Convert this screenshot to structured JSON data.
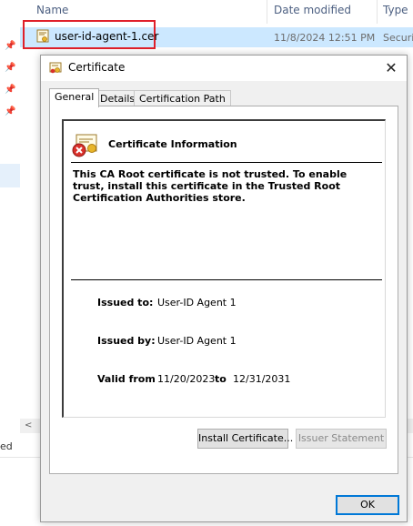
{
  "explorer": {
    "columns": {
      "name": "Name",
      "date_modified": "Date modified",
      "type": "Type"
    },
    "selected_file": {
      "name": "user-id-agent-1.cer",
      "date": "11/8/2024 12:51 PM",
      "type": "Securi"
    },
    "scroll_left_arrow": "<",
    "status_partial": "ed"
  },
  "dialog": {
    "title": "Certificate",
    "close_glyph": "✕",
    "tabs": [
      "General",
      "Details",
      "Certification Path"
    ],
    "active_tab": "General",
    "info_title": "Certificate Information",
    "message": "This CA Root certificate is not trusted. To enable trust, install this certificate in the Trusted Root Certification Authorities store.",
    "issued_to_label": "Issued to:",
    "issued_to": "User-ID Agent 1",
    "issued_by_label": "Issued by:",
    "issued_by": "User-ID Agent 1",
    "valid_from_label": "Valid from",
    "valid_from": "11/20/2023",
    "valid_to_label": "to",
    "valid_to": "12/31/2031",
    "install_button": "Install Certificate...",
    "issuer_statement_button": "Issuer Statement",
    "ok_button": "OK"
  },
  "icons": {
    "certificate": "certificate-icon",
    "error": "error-icon",
    "pin": "pin-icon"
  },
  "colors": {
    "selection_highlight": "#cce8ff",
    "red_outline": "#e0202a",
    "default_button_border": "#0078d7",
    "header_text": "#4d6082"
  }
}
